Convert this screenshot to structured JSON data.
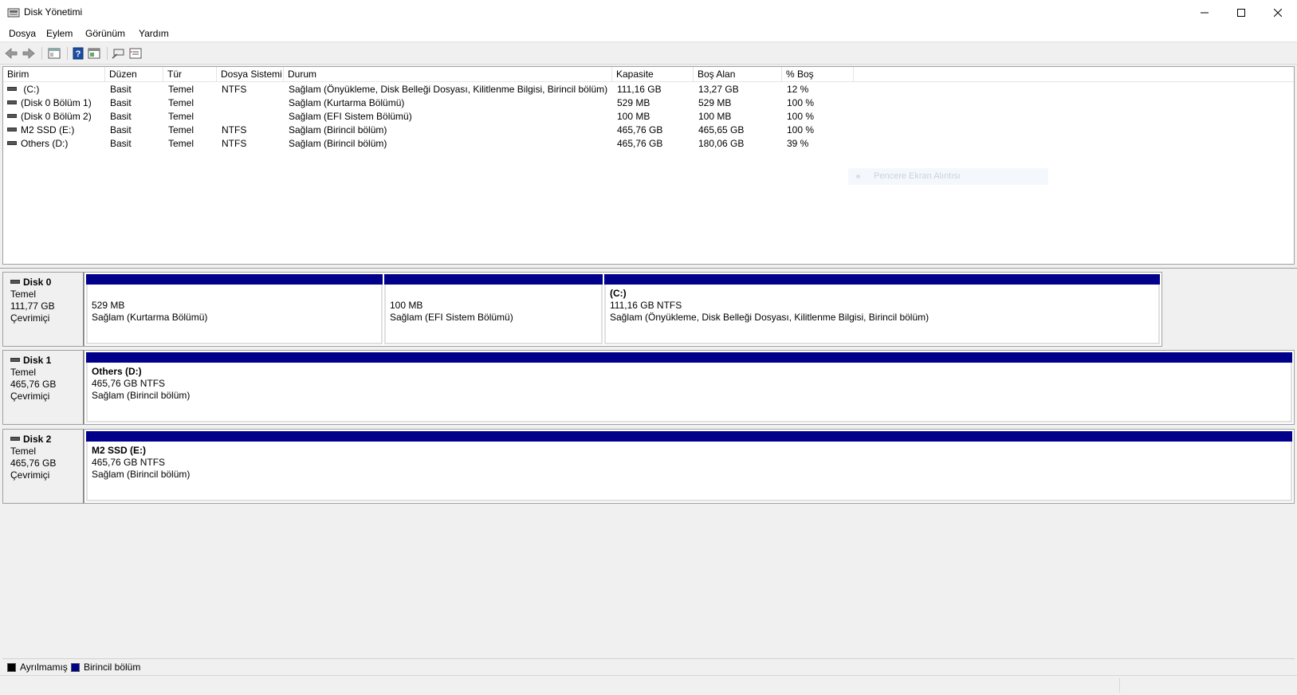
{
  "window": {
    "title": "Disk Yönetimi"
  },
  "menu": [
    "Dosya",
    "Eylem",
    "Görünüm",
    "Yardım"
  ],
  "toolbar": {
    "buttons": [
      "back-icon",
      "forward-icon",
      "console-tree-icon",
      "help-icon",
      "properties-icon",
      "connect-icon",
      "settings-icon"
    ]
  },
  "volume_list": {
    "columns": [
      "Birim",
      "Düzen",
      "Tür",
      "Dosya Sistemi",
      "Durum",
      "Kapasite",
      "Boş Alan",
      "% Boş"
    ],
    "rows": [
      {
        "birim": " (C:)",
        "duzen": "Basit",
        "tur": "Temel",
        "dosya_sistemi": "NTFS",
        "durum": "Sağlam (Önyükleme, Disk Belleği Dosyası, Kilitlenme Bilgisi, Birincil bölüm)",
        "kapasite": "111,16 GB",
        "bos_alan": "13,27 GB",
        "yuzde_bos": "12 %"
      },
      {
        "birim": "(Disk 0 Bölüm 1)",
        "duzen": "Basit",
        "tur": "Temel",
        "dosya_sistemi": "",
        "durum": "Sağlam (Kurtarma Bölümü)",
        "kapasite": "529 MB",
        "bos_alan": "529 MB",
        "yuzde_bos": "100 %"
      },
      {
        "birim": "(Disk 0 Bölüm 2)",
        "duzen": "Basit",
        "tur": "Temel",
        "dosya_sistemi": "",
        "durum": "Sağlam (EFI Sistem Bölümü)",
        "kapasite": "100 MB",
        "bos_alan": "100 MB",
        "yuzde_bos": "100 %"
      },
      {
        "birim": "M2 SSD (E:)",
        "duzen": "Basit",
        "tur": "Temel",
        "dosya_sistemi": "NTFS",
        "durum": "Sağlam (Birincil bölüm)",
        "kapasite": "465,76 GB",
        "bos_alan": "465,65 GB",
        "yuzde_bos": "100 %"
      },
      {
        "birim": "Others (D:)",
        "duzen": "Basit",
        "tur": "Temel",
        "dosya_sistemi": "NTFS",
        "durum": "Sağlam (Birincil bölüm)",
        "kapasite": "465,76 GB",
        "bos_alan": "180,06 GB",
        "yuzde_bos": "39 %"
      }
    ],
    "ghost_tooltip": "Pencere Ekran Alıntısı"
  },
  "disks": [
    {
      "name": "Disk 0",
      "type": "Temel",
      "size": "111,77 GB",
      "status": "Çevrimiçi",
      "partitions": [
        {
          "name": "",
          "size_fs": "529 MB",
          "status": "Sağlam (Kurtarma Bölümü)"
        },
        {
          "name": "",
          "size_fs": "100 MB",
          "status": "Sağlam (EFI Sistem Bölümü)"
        },
        {
          "name": " (C:)",
          "size_fs": "111,16 GB NTFS",
          "status": "Sağlam (Önyükleme, Disk Belleği Dosyası, Kilitlenme Bilgisi, Birincil bölüm)"
        }
      ]
    },
    {
      "name": "Disk 1",
      "type": "Temel",
      "size": "465,76 GB",
      "status": "Çevrimiçi",
      "partitions": [
        {
          "name": "Others  (D:)",
          "size_fs": "465,76 GB NTFS",
          "status": "Sağlam (Birincil bölüm)"
        }
      ]
    },
    {
      "name": "Disk 2",
      "type": "Temel",
      "size": "465,76 GB",
      "status": "Çevrimiçi",
      "partitions": [
        {
          "name": "M2 SSD  (E:)",
          "size_fs": "465,76 GB NTFS",
          "status": "Sağlam (Birincil bölüm)"
        }
      ]
    }
  ],
  "legend": [
    {
      "label": "Ayrılmamış",
      "color": "#000000"
    },
    {
      "label": "Birincil bölüm",
      "color": "#00008b"
    }
  ],
  "colors": {
    "primary_partition": "#00008b",
    "unallocated": "#000000"
  }
}
